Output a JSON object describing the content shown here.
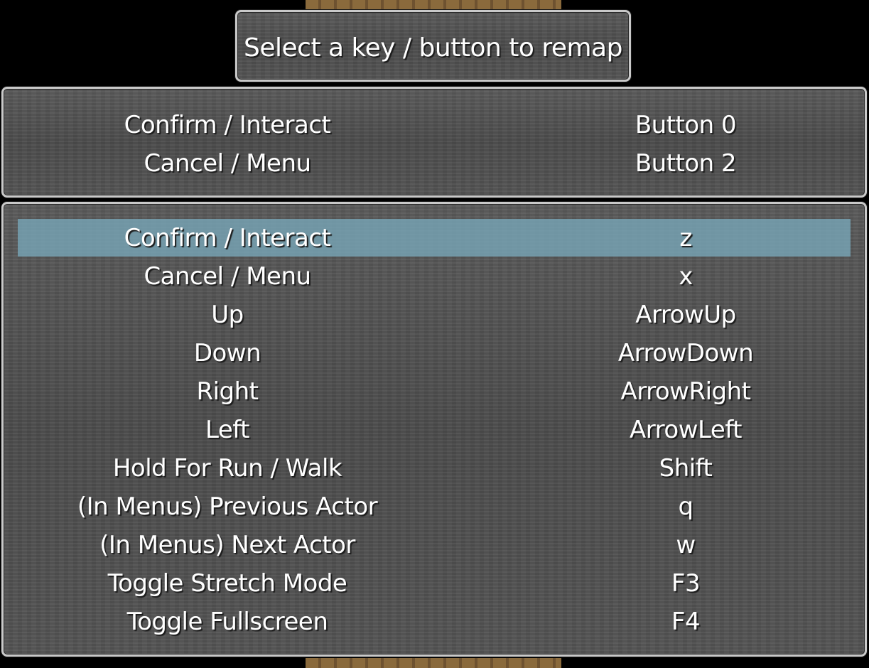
{
  "help": {
    "text": "Select a key / button to remap"
  },
  "gamepad": {
    "rows": [
      {
        "action": "Confirm / Interact",
        "binding": "Button 0"
      },
      {
        "action": "Cancel / Menu",
        "binding": "Button 2"
      }
    ]
  },
  "keyboard": {
    "selected_index": 0,
    "highlight_color": "#78a8ba",
    "rows": [
      {
        "action": "Confirm / Interact",
        "binding": "z"
      },
      {
        "action": "Cancel / Menu",
        "binding": "x"
      },
      {
        "action": "Up",
        "binding": "ArrowUp"
      },
      {
        "action": "Down",
        "binding": "ArrowDown"
      },
      {
        "action": "Right",
        "binding": "ArrowRight"
      },
      {
        "action": "Left",
        "binding": "ArrowLeft"
      },
      {
        "action": "Hold For Run / Walk",
        "binding": "Shift"
      },
      {
        "action": "(In Menus) Previous Actor",
        "binding": "q"
      },
      {
        "action": "(In Menus) Next Actor",
        "binding": "w"
      },
      {
        "action": "Toggle Stretch Mode",
        "binding": "F3"
      },
      {
        "action": "Toggle Fullscreen",
        "binding": "F4"
      }
    ]
  }
}
